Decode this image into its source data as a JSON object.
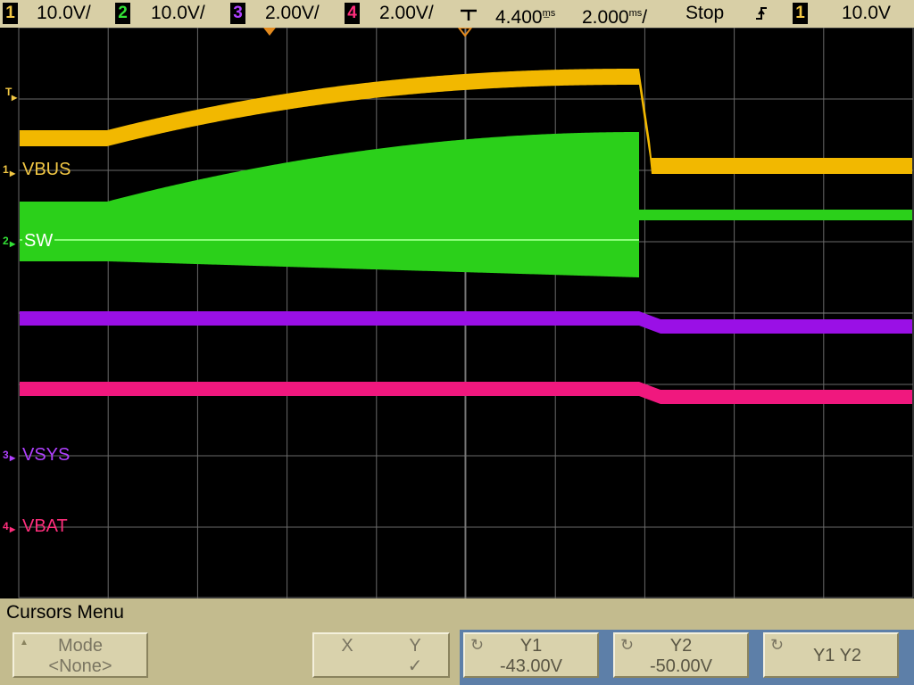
{
  "status": {
    "ch1_num": "1",
    "ch1_scale": "10.0V/",
    "ch2_num": "2",
    "ch2_scale": "10.0V/",
    "ch3_num": "3",
    "ch3_scale": "2.00V/",
    "ch4_num": "4",
    "ch4_scale": "2.00V/",
    "time_delay": "4.400",
    "time_delay_unit": "m̲s",
    "time_scale": "2.000",
    "time_scale_unit": "ms",
    "time_scale_suffix": "/",
    "run_state": "Stop",
    "trigger_source": "1",
    "trigger_level": "10.0V"
  },
  "channels": {
    "ch1": {
      "num": "1",
      "label": "VBUS"
    },
    "ch2": {
      "num": "2",
      "label": "SW"
    },
    "ch3": {
      "num": "3",
      "label": "VSYS"
    },
    "ch4": {
      "num": "4",
      "label": "VBAT"
    },
    "trigger_marker": "T"
  },
  "menu": {
    "title": "Cursors Menu",
    "mode_label": "Mode",
    "mode_value": "<None>",
    "x_label": "X",
    "y_label": "Y",
    "y_check": "✓",
    "y1_label": "Y1",
    "y1_value": "-43.00V",
    "y2_label": "Y2",
    "y2_value": "-50.00V",
    "y1y2_label": "Y1 Y2"
  },
  "colors": {
    "ch1": "#f2b800",
    "ch2": "#2bd01a",
    "ch3": "#9a10e6",
    "ch4": "#f0187e",
    "grid": "#6a6a6a",
    "panel": "#d8cfa6",
    "cursor_group": "#5d7fa8"
  }
}
